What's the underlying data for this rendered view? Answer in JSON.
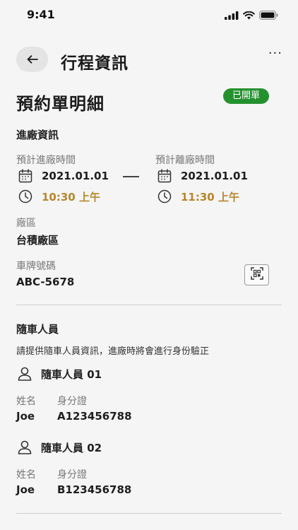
{
  "status_bar": {
    "time": "9:41"
  },
  "header": {
    "title": "行程資訊",
    "more": "···"
  },
  "reservation": {
    "title": "預約單明細",
    "status": "已開單",
    "status_color": "#24912f"
  },
  "entry": {
    "title": "進廠資訊",
    "entry_label": "預計進廠時間",
    "entry_date": "2021.01.01",
    "entry_time": "10:30 上午",
    "exit_label": "預計離廠時間",
    "exit_date": "2021.01.01",
    "exit_time": "11:30 上午",
    "area_label": "廠區",
    "area_value": "台積廠區",
    "plate_label": "車牌號碼",
    "plate_value": "ABC-5678"
  },
  "companions": {
    "title": "隨車人員",
    "note": "請提供隨車人員資訊，進廠時將會進行身份驗正",
    "name_label": "姓名",
    "id_label": "身分證",
    "people": [
      {
        "heading": "隨車人員 01",
        "name": "Joe",
        "id": "A123456788"
      },
      {
        "heading": "隨車人員 02",
        "name": "Joe",
        "id": "B123456788"
      }
    ]
  },
  "icons": [
    "signal-icon",
    "wifi-icon",
    "battery-icon",
    "back-arrow-icon",
    "more-icon",
    "calendar-icon",
    "clock-icon",
    "qr-scan-icon",
    "person-icon"
  ],
  "colors": {
    "accent_time": "#b7862b",
    "badge_green": "#24912f",
    "background": "#f5f5f5"
  }
}
